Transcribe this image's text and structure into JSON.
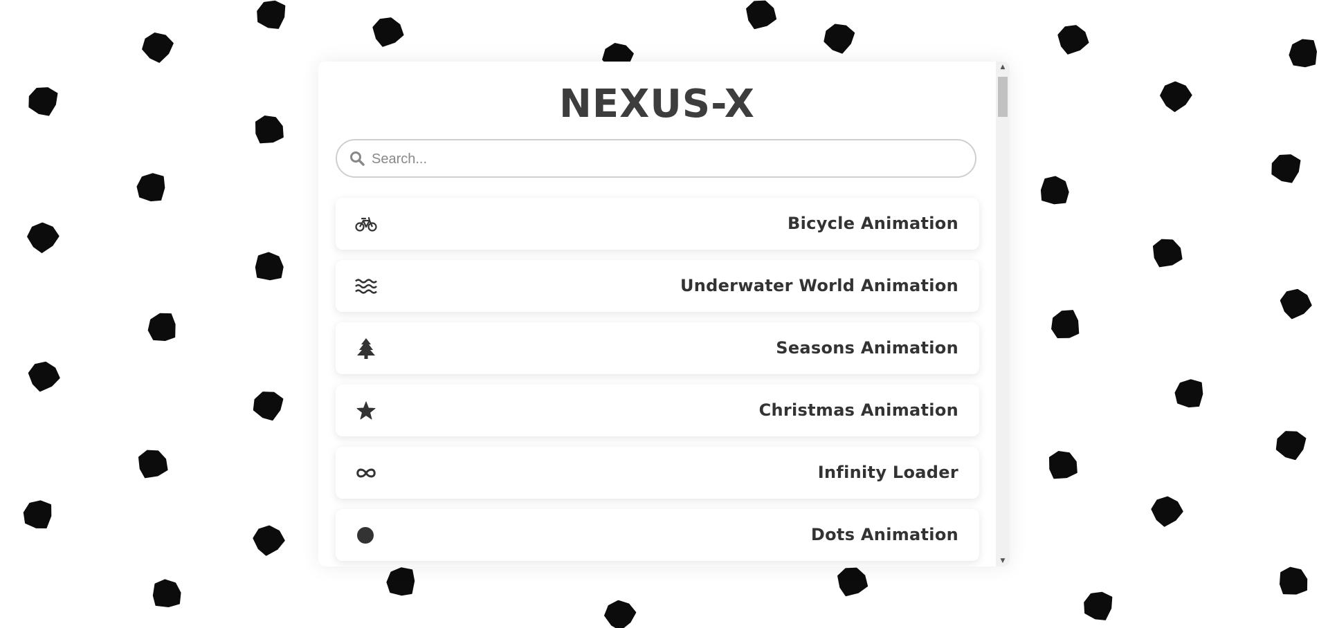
{
  "app": {
    "title": "NEXUS-X"
  },
  "search": {
    "placeholder": "Search...",
    "value": "",
    "icon": "search-icon"
  },
  "items": [
    {
      "label": "Bicycle Animation",
      "icon": "bicycle-icon"
    },
    {
      "label": "Underwater World Animation",
      "icon": "water-icon"
    },
    {
      "label": "Seasons Animation",
      "icon": "tree-icon"
    },
    {
      "label": "Christmas Animation",
      "icon": "star-icon"
    },
    {
      "label": "Infinity Loader",
      "icon": "infinity-icon"
    },
    {
      "label": "Dots Animation",
      "icon": "circle-icon"
    }
  ],
  "colors": {
    "title": "#3d3d3d",
    "text": "#333333",
    "background": "#ffffff",
    "pattern": "#0c0c0c"
  }
}
